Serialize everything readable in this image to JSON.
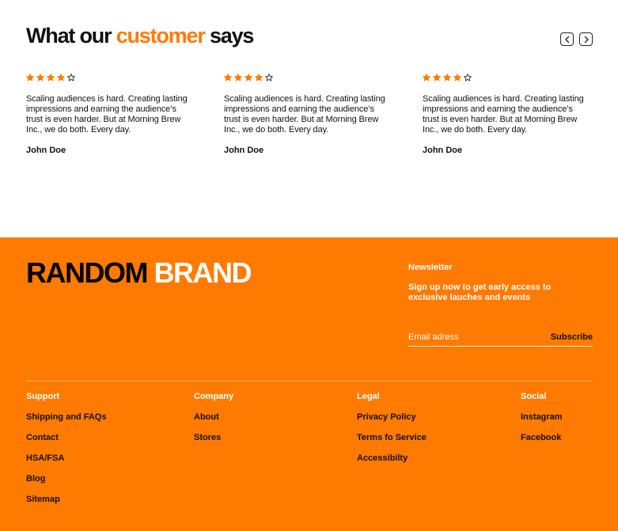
{
  "testimonials": {
    "heading_prefix": "What our ",
    "heading_accent": "customer",
    "heading_suffix": " says",
    "accent_color": "#ff7a00",
    "prev_icon": "chevron-left-icon",
    "next_icon": "chevron-right-icon",
    "cards": [
      {
        "rating": 4,
        "max_rating": 5,
        "quote": "Scaling audiences is hard. Creating lasting impressions and earning the audience’s trust is even harder. But at Morning Brew Inc., we do both. Every day.",
        "author": "John Doe"
      },
      {
        "rating": 4,
        "max_rating": 5,
        "quote": "Scaling audiences is hard. Creating lasting impressions and earning the audience’s trust is even harder. But at Morning Brew Inc., we do both. Every day.",
        "author": "John Doe"
      },
      {
        "rating": 4,
        "max_rating": 5,
        "quote": "Scaling audiences is hard. Creating lasting impressions and earning the audience’s trust is even harder. But at Morning Brew Inc., we do both. Every day.",
        "author": "John Doe"
      }
    ]
  },
  "footer": {
    "background_color": "#ff7a00",
    "brand_part1": "RANDOM",
    "brand_part2": "BRAND",
    "newsletter": {
      "title": "Newsletter",
      "text": "Sign up now to get early access to exclusive lauches and events",
      "email_placeholder": "Email adress",
      "email_value": "",
      "subscribe_label": "Subscribe"
    },
    "columns": [
      {
        "title": "Support",
        "links": [
          "Shipping and FAQs",
          "Contact",
          "HSA/FSA",
          "Blog",
          "Sitemap"
        ]
      },
      {
        "title": "Company",
        "links": [
          "About",
          "Stores"
        ]
      },
      {
        "title": "Legal",
        "links": [
          "Privacy Policy",
          "Terms fo Service",
          "Accessibilty"
        ]
      },
      {
        "title": "Social",
        "links": [
          "Instagram",
          "Facebook"
        ]
      }
    ]
  }
}
